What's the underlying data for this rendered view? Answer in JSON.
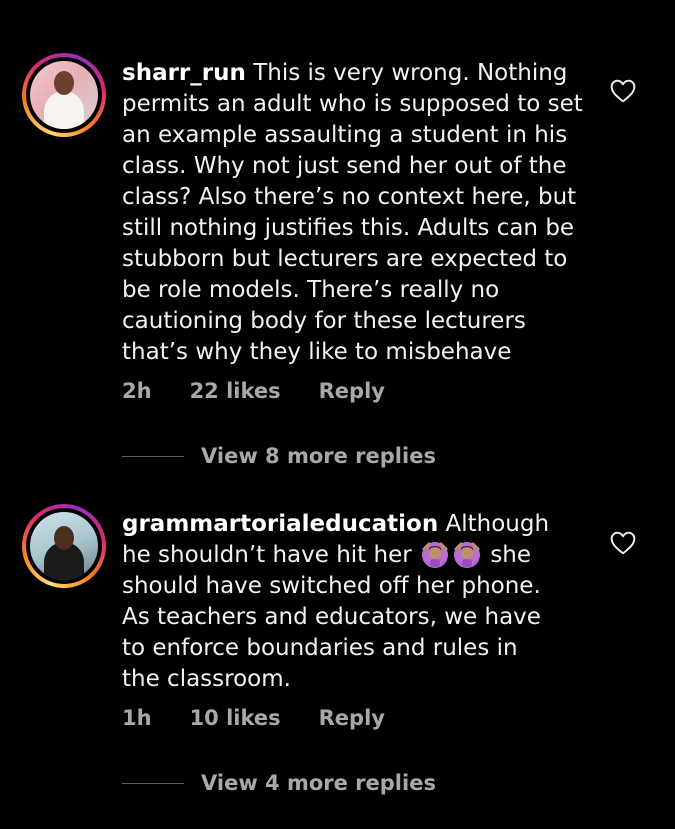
{
  "comments": [
    {
      "username": "sharr_run",
      "text": "This is very wrong. Nothing permits an adult who is supposed to set an example assaulting a student in his class. Why not just send her out of the class? Also there’s no context here, but still nothing justifies this. Adults can be stubborn but lecturers are expected to be role models. There’s really no cautioning body for these lecturers that’s why they like to misbehave",
      "time": "2h",
      "likes": "22 likes",
      "reply_label": "Reply",
      "view_replies": "View 8 more replies"
    },
    {
      "username": "grammartorialeducation",
      "text_before": "Although he shouldn’t have hit her",
      "emojis": "🙆🏽‍♀️🙆🏽‍♀️",
      "text_after": "she should have switched off her phone. As teachers and educators, we have to enforce boundaries and rules in the classroom.",
      "time": "1h",
      "likes": "10 likes",
      "reply_label": "Reply",
      "view_replies": "View 4 more replies"
    }
  ],
  "colors": {
    "background": "#000000",
    "text": "#f2f2f2",
    "secondary_text": "#a8a8a8",
    "story_ring": [
      "#feda75",
      "#fa7e1e",
      "#d62976",
      "#962fbf"
    ]
  },
  "icons": {
    "like": "heart-outline-icon",
    "emoji": "person-gesturing-ok-emoji"
  }
}
